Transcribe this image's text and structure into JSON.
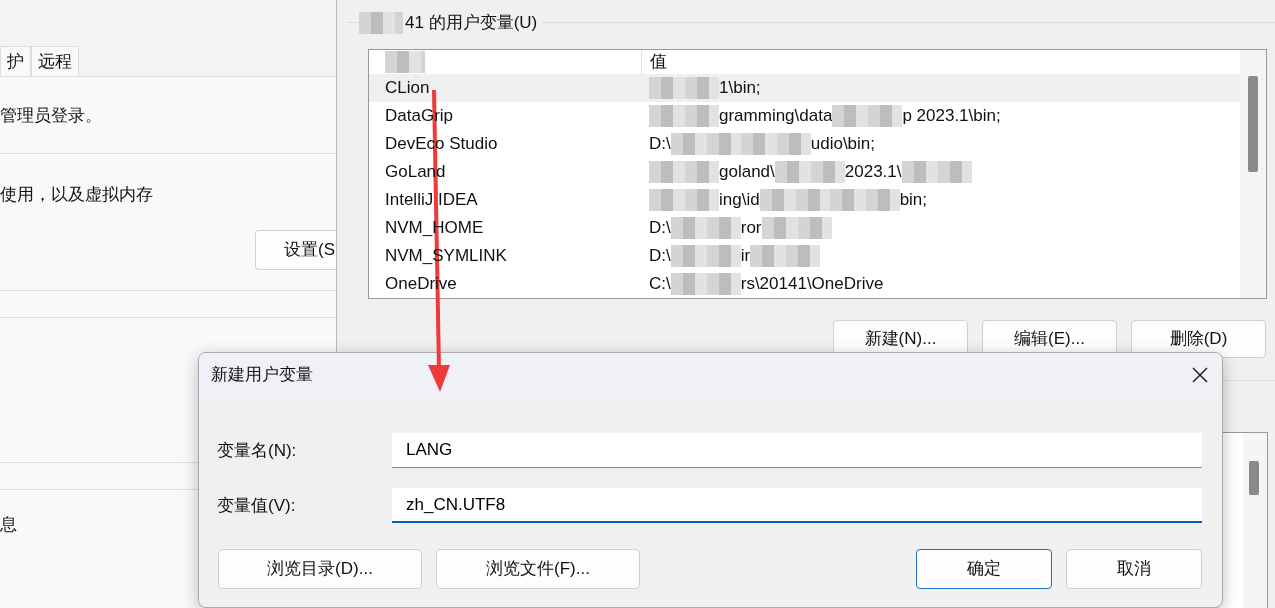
{
  "background_window": {
    "tabs": [
      {
        "label": "护"
      },
      {
        "label": "远程"
      }
    ],
    "texts": [
      "管理员登录。",
      "使用，以及虚拟内存"
    ],
    "settings_button": "设置(S",
    "footer_text": "息"
  },
  "env_window": {
    "group_title": "41 的用户变量(U)",
    "value_column": "值",
    "rows": [
      {
        "name": "CLion",
        "selected": true,
        "value": [
          {
            "kind": "redacted"
          },
          {
            "kind": "text",
            "text": "1\\bin;"
          }
        ]
      },
      {
        "name": "DataGrip",
        "selected": false,
        "value": [
          {
            "kind": "redacted"
          },
          {
            "kind": "text",
            "text": "gramming\\data"
          },
          {
            "kind": "redacted"
          },
          {
            "kind": "text",
            "text": "p 2023.1\\bin;"
          }
        ]
      },
      {
        "name": "DevEco Studio",
        "selected": false,
        "value": [
          {
            "kind": "text",
            "text": "D:\\"
          },
          {
            "kind": "redacted"
          },
          {
            "kind": "redacted"
          },
          {
            "kind": "text",
            "text": "udio\\bin;"
          }
        ]
      },
      {
        "name": "GoLand",
        "selected": false,
        "value": [
          {
            "kind": "redacted"
          },
          {
            "kind": "text",
            "text": "goland\\"
          },
          {
            "kind": "redacted"
          },
          {
            "kind": "text",
            "text": "2023.1\\"
          },
          {
            "kind": "redacted"
          }
        ]
      },
      {
        "name": "IntelliJ IDEA",
        "selected": false,
        "value": [
          {
            "kind": "redacted"
          },
          {
            "kind": "text",
            "text": "ing\\id"
          },
          {
            "kind": "redacted"
          },
          {
            "kind": "redacted"
          },
          {
            "kind": "text",
            "text": "bin;"
          }
        ]
      },
      {
        "name": "NVM_HOME",
        "selected": false,
        "value": [
          {
            "kind": "text",
            "text": "D:\\"
          },
          {
            "kind": "redacted"
          },
          {
            "kind": "text",
            "text": "ror"
          },
          {
            "kind": "redacted"
          }
        ]
      },
      {
        "name": "NVM_SYMLINK",
        "selected": false,
        "value": [
          {
            "kind": "text",
            "text": "D:\\"
          },
          {
            "kind": "redacted"
          },
          {
            "kind": "text",
            "text": "ir"
          },
          {
            "kind": "redacted"
          }
        ]
      },
      {
        "name": "OneDrive",
        "selected": false,
        "value": [
          {
            "kind": "text",
            "text": "C:\\"
          },
          {
            "kind": "redacted"
          },
          {
            "kind": "text",
            "text": "rs\\20141\\OneDrive"
          }
        ]
      }
    ],
    "buttons": [
      "新建(N)...",
      "编辑(E)...",
      "删除(D)"
    ]
  },
  "dialog": {
    "title": "新建用户变量",
    "fields": [
      {
        "label": "变量名(N):",
        "value": "LANG",
        "focused": false
      },
      {
        "label": "变量值(V):",
        "value": "zh_CN.UTF8",
        "focused": true
      }
    ],
    "browse_buttons": [
      "浏览目录(D)...",
      "浏览文件(F)..."
    ],
    "actions": [
      {
        "label": "确定",
        "default": true
      },
      {
        "label": "取消",
        "default": false
      }
    ]
  }
}
